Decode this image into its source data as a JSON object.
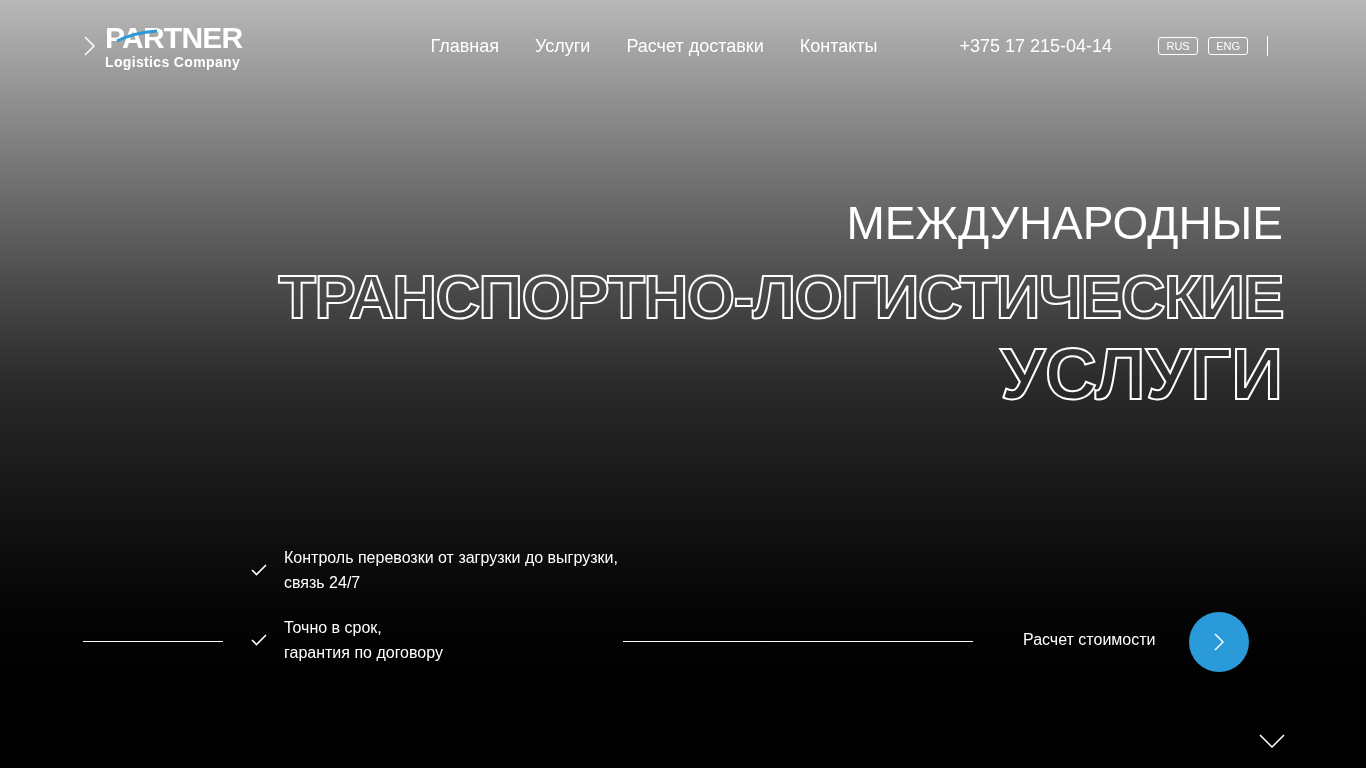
{
  "logo": {
    "name": "PARTNER",
    "tagline": "Logistics Company"
  },
  "nav": [
    {
      "label": "Главная"
    },
    {
      "label": "Услуги"
    },
    {
      "label": "Расчет доставки"
    },
    {
      "label": "Контакты"
    }
  ],
  "phone": "+375 17 215-04-14",
  "languages": [
    "RUS",
    "ENG"
  ],
  "hero": {
    "line_1": "МЕЖДУНАРОДНЫЕ",
    "line_2": "ТРАНСПОРТНО-ЛОГИСТИЧЕСКИЕ",
    "line_3": "УСЛУГИ"
  },
  "features": [
    "Контроль перевозки от загрузки до выгрузки,\nсвязь 24/7",
    "Точно в срок,\nгарантия по договору"
  ],
  "cta": {
    "label": "Расчет стоимости"
  }
}
